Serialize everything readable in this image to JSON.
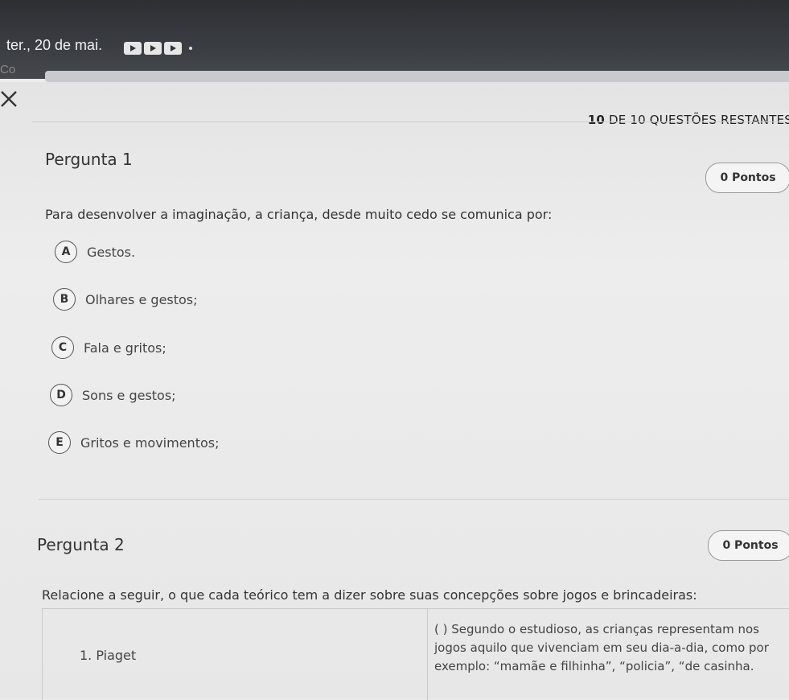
{
  "status_bar": {
    "date": "ter., 20 de mai.",
    "notification_icons": [
      "play-icon",
      "play-icon",
      "play-icon"
    ]
  },
  "tab_fragment": "Co",
  "header": {
    "remaining_count": "10",
    "remaining_text": "DE 10 QUESTÕES RESTANTES"
  },
  "questions": [
    {
      "title": "Pergunta 1",
      "points": "0 Pontos",
      "text": "Para desenvolver a imaginação, a criança, desde muito cedo se comunica por:",
      "options": [
        {
          "letter": "A",
          "text": "Gestos."
        },
        {
          "letter": "B",
          "text": "Olhares e gestos;"
        },
        {
          "letter": "C",
          "text": "Fala e gritos;"
        },
        {
          "letter": "D",
          "text": "Sons e gestos;"
        },
        {
          "letter": "E",
          "text": "Gritos e movimentos;"
        }
      ]
    },
    {
      "title": "Pergunta 2",
      "points": "0 Pontos",
      "text": "Relacione a seguir, o que cada teórico tem a dizer sobre suas concepções sobre jogos e brincadeiras:",
      "table": {
        "left": "1.    Piaget",
        "right": "( ) Segundo o estudioso, as crianças representam nos jogos aquilo que vivenciam em seu dia-a-dia, como por exemplo: “mamãe e filhinha”, “policia”, “de casinha."
      }
    }
  ]
}
